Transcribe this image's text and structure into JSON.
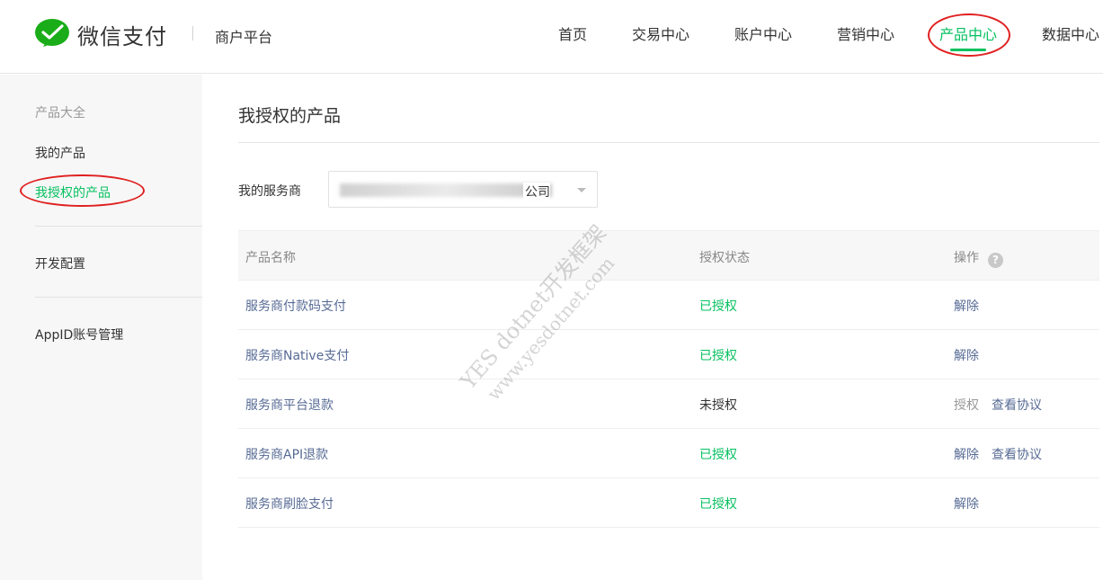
{
  "header": {
    "brand_name": "微信支付",
    "platform": "商户平台",
    "nav": [
      {
        "label": "首页",
        "active": false
      },
      {
        "label": "交易中心",
        "active": false
      },
      {
        "label": "账户中心",
        "active": false
      },
      {
        "label": "营销中心",
        "active": false
      },
      {
        "label": "产品中心",
        "active": true
      },
      {
        "label": "数据中心",
        "active": false
      }
    ]
  },
  "sidebar": {
    "group_title": "产品大全",
    "items": [
      {
        "label": "我的产品",
        "active": false
      },
      {
        "label": "我授权的产品",
        "active": true
      },
      {
        "label": "开发配置",
        "active": false
      },
      {
        "label": "AppID账号管理",
        "active": false
      }
    ]
  },
  "main": {
    "title": "我授权的产品",
    "filter": {
      "label": "我的服务商",
      "value_visible_suffix": "公司"
    },
    "table": {
      "columns": [
        "产品名称",
        "授权状态",
        "操作"
      ],
      "rows": [
        {
          "name": "服务商付款码支付",
          "status": "已授权",
          "status_type": "ok",
          "actions": [
            "解除"
          ]
        },
        {
          "name": "服务商Native支付",
          "status": "已授权",
          "status_type": "ok",
          "actions": [
            "解除"
          ]
        },
        {
          "name": "服务商平台退款",
          "status": "未授权",
          "status_type": "no",
          "actions": [
            "授权",
            "查看协议"
          ]
        },
        {
          "name": "服务商API退款",
          "status": "已授权",
          "status_type": "ok",
          "actions": [
            "解除",
            "查看协议"
          ]
        },
        {
          "name": "服务商刷脸支付",
          "status": "已授权",
          "status_type": "ok",
          "actions": [
            "解除"
          ]
        }
      ]
    }
  },
  "watermark": {
    "line1": "YES dotnet开发框架",
    "line2": "www.yesdotnet.com"
  },
  "colors": {
    "brand_green": "#07c160",
    "link_blue": "#576b95",
    "annotation_red": "#e02020"
  }
}
